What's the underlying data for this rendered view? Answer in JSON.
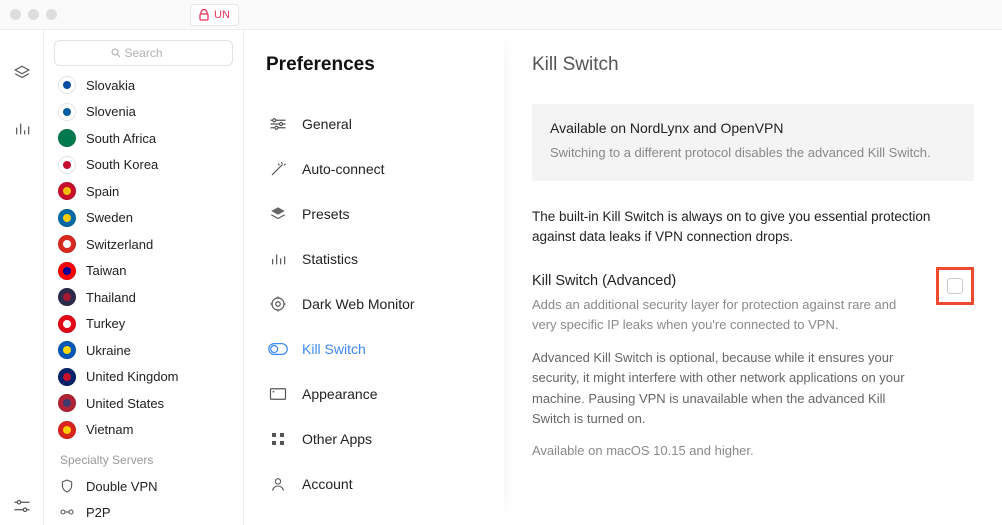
{
  "header": {
    "unprotected_label": "UN"
  },
  "search": {
    "placeholder": "Search"
  },
  "countries": [
    {
      "name": "Slovakia",
      "flag_bg": "#fff",
      "flag_fg": "#0b4ea2"
    },
    {
      "name": "Slovenia",
      "flag_bg": "#fff",
      "flag_fg": "#005da4"
    },
    {
      "name": "South Africa",
      "flag_bg": "#007a4d",
      "flag_fg": ""
    },
    {
      "name": "South Korea",
      "flag_bg": "#fff",
      "flag_fg": "#c60c30"
    },
    {
      "name": "Spain",
      "flag_bg": "#c8102e",
      "flag_fg": "#f1bf00"
    },
    {
      "name": "Sweden",
      "flag_bg": "#006aa7",
      "flag_fg": "#fecc00"
    },
    {
      "name": "Switzerland",
      "flag_bg": "#d52b1e",
      "flag_fg": "#fff"
    },
    {
      "name": "Taiwan",
      "flag_bg": "#fe0000",
      "flag_fg": "#000095"
    },
    {
      "name": "Thailand",
      "flag_bg": "#2d2a4a",
      "flag_fg": "#a51931"
    },
    {
      "name": "Turkey",
      "flag_bg": "#e30a17",
      "flag_fg": "#fff"
    },
    {
      "name": "Ukraine",
      "flag_bg": "#0057b7",
      "flag_fg": "#ffd700"
    },
    {
      "name": "United Kingdom",
      "flag_bg": "#012169",
      "flag_fg": "#c8102e"
    },
    {
      "name": "United States",
      "flag_bg": "#b22234",
      "flag_fg": "#3c3b6e"
    },
    {
      "name": "Vietnam",
      "flag_bg": "#da251d",
      "flag_fg": "#ffcd00"
    }
  ],
  "specialty": {
    "label": "Specialty Servers",
    "items": [
      {
        "name": "Double VPN",
        "icon": "shield"
      },
      {
        "name": "P2P",
        "icon": "p2p"
      }
    ]
  },
  "preferences": {
    "title": "Preferences",
    "items": [
      {
        "label": "General",
        "icon": "sliders"
      },
      {
        "label": "Auto-connect",
        "icon": "wand"
      },
      {
        "label": "Presets",
        "icon": "layers"
      },
      {
        "label": "Statistics",
        "icon": "bars"
      },
      {
        "label": "Dark Web Monitor",
        "icon": "target"
      },
      {
        "label": "Kill Switch",
        "icon": "switch",
        "active": true
      },
      {
        "label": "Appearance",
        "icon": "rect"
      },
      {
        "label": "Other Apps",
        "icon": "grid"
      },
      {
        "label": "Account",
        "icon": "user"
      }
    ]
  },
  "detail": {
    "heading": "Kill Switch",
    "info_title": "Available on NordLynx and OpenVPN",
    "info_sub": "Switching to a different protocol disables the advanced Kill Switch.",
    "paragraph": "The built-in Kill Switch is always on to give you essential protection against data leaks if VPN connection drops.",
    "adv_title": "Kill Switch (Advanced)",
    "adv_sub": "Adds an additional security layer for protection against rare and very specific IP leaks when you're connected to VPN.",
    "adv_para": "Advanced Kill Switch is optional, because while it ensures your security, it might interfere with other network applications on your machine. Pausing VPN is unavailable when the advanced Kill Switch is turned on.",
    "adv_note": "Available on macOS 10.15 and higher."
  }
}
